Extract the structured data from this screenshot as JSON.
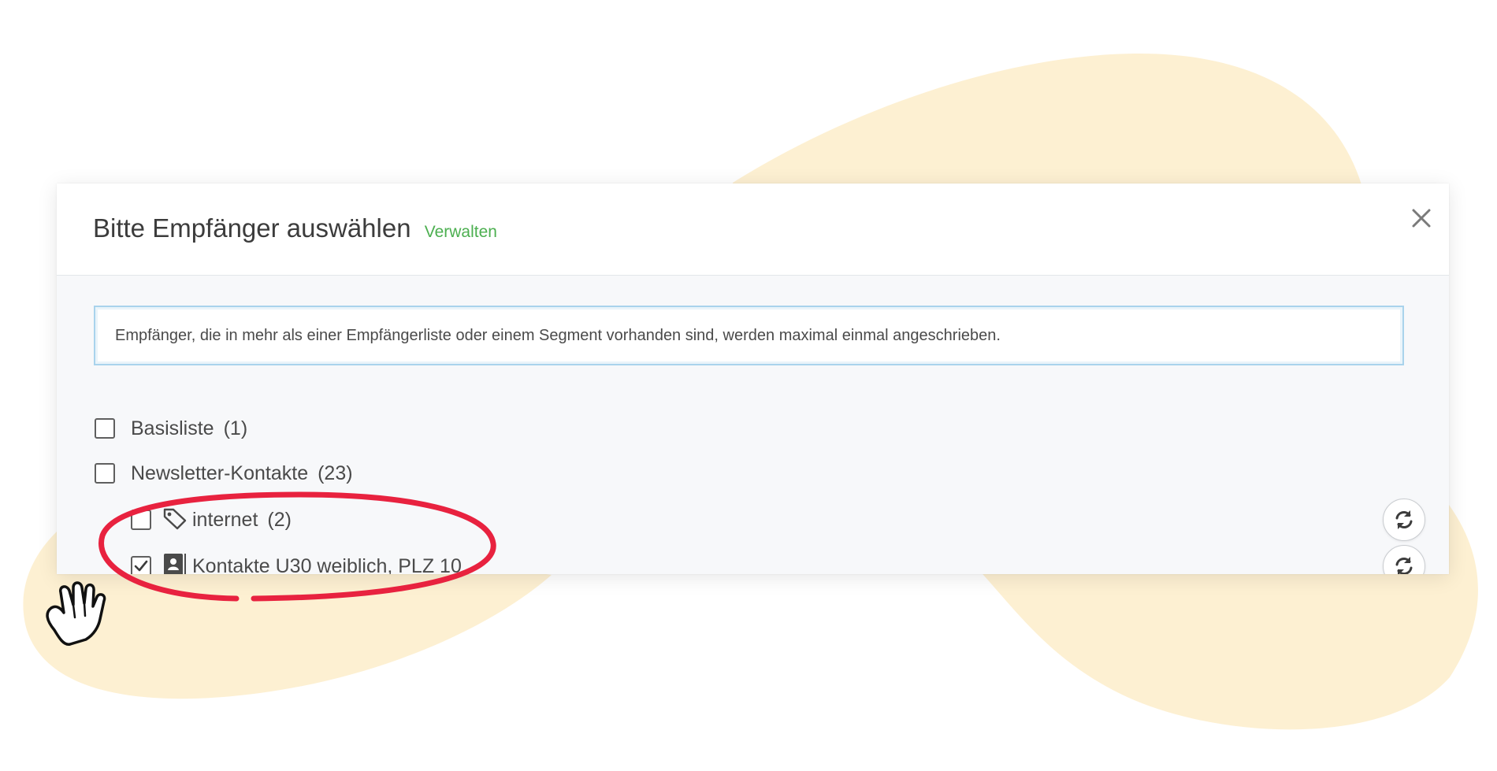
{
  "dialog": {
    "title": "Bitte Empfänger auswählen",
    "manage_link": "Verwalten",
    "close_icon": "close-icon"
  },
  "info_message": "Empfänger, die in mehr als einer Empfängerliste oder einem Segment vorhanden sind, werden maximal einmal angeschrieben.",
  "recipient_lists": [
    {
      "label": "Basisliste",
      "count": "(1)",
      "checked": false,
      "level": 0
    },
    {
      "label": "Newsletter-Kontakte",
      "count": "(23)",
      "checked": false,
      "level": 0
    },
    {
      "label": "internet",
      "count": "(2)",
      "checked": false,
      "level": 1,
      "icon": "tag-icon",
      "action_icon": "refresh-icon"
    },
    {
      "label": "Kontakte U30 weiblich, PLZ 10",
      "count": "",
      "checked": true,
      "level": 1,
      "icon": "address-book-icon",
      "action_icon": "refresh-icon"
    }
  ],
  "colors": {
    "accent_link": "#4caf50",
    "info_border": "#a9d3ec",
    "highlight_ring": "#e8223f",
    "background_blob": "#fdf0d2"
  },
  "annotations": {
    "highlight": "red-ellipse-highlight",
    "pointer": "hand-pointer-icon"
  }
}
